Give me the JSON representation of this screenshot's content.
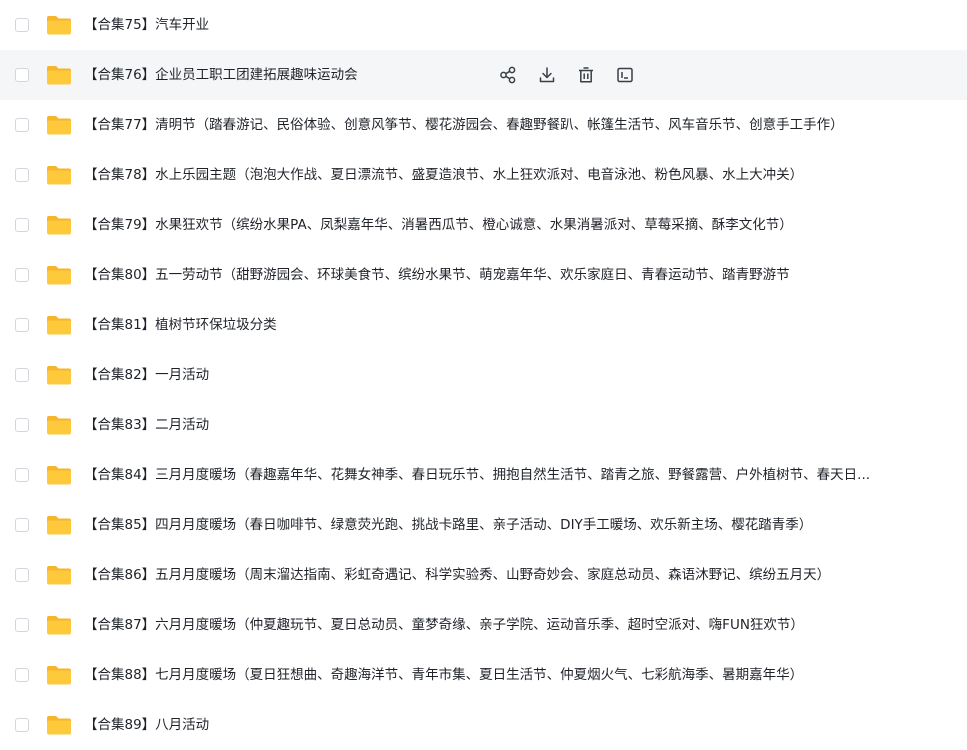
{
  "file_list": {
    "items": [
      {
        "name": "【合集75】汽车开业",
        "icon": "folder-icon"
      },
      {
        "name": "【合集76】企业员工职工团建拓展趣味运动会",
        "icon": "folder-icon",
        "hovered": true
      },
      {
        "name": "【合集77】清明节（踏春游记、民俗体验、创意风筝节、樱花游园会、春趣野餐趴、帐篷生活节、风车音乐节、创意手工手作）",
        "icon": "folder-icon"
      },
      {
        "name": "【合集78】水上乐园主题（泡泡大作战、夏日漂流节、盛夏造浪节、水上狂欢派对、电音泳池、粉色风暴、水上大冲关）",
        "icon": "folder-icon"
      },
      {
        "name": "【合集79】水果狂欢节（缤纷水果PA、凤梨嘉年华、消暑西瓜节、橙心诚意、水果消暑派对、草莓采摘、酥李文化节）",
        "icon": "folder-icon"
      },
      {
        "name": "【合集80】五一劳动节（甜野游园会、环球美食节、缤纷水果节、萌宠嘉年华、欢乐家庭日、青春运动节、踏青野游节",
        "icon": "folder-icon"
      },
      {
        "name": "【合集81】植树节环保垃圾分类",
        "icon": "folder-icon"
      },
      {
        "name": "【合集82】一月活动",
        "icon": "folder-icon"
      },
      {
        "name": "【合集83】二月活动",
        "icon": "folder-icon"
      },
      {
        "name": "【合集84】三月月度暖场（春趣嘉年华、花舞女神季、春日玩乐节、拥抱自然生活节、踏青之旅、野餐露营、户外植树节、春天日...",
        "icon": "folder-icon"
      },
      {
        "name": "【合集85】四月月度暖场（春日咖啡节、绿意荧光跑、挑战卡路里、亲子活动、DIY手工暖场、欢乐新主场、樱花踏青季）",
        "icon": "folder-icon"
      },
      {
        "name": "【合集86】五月月度暖场（周末溜达指南、彩虹奇遇记、科学实验秀、山野奇妙会、家庭总动员、森语沐野记、缤纷五月天）",
        "icon": "folder-icon"
      },
      {
        "name": "【合集87】六月月度暖场（仲夏趣玩节、夏日总动员、童梦奇缘、亲子学院、运动音乐季、超时空派对、嗨FUN狂欢节）",
        "icon": "folder-icon"
      },
      {
        "name": "【合集88】七月月度暖场（夏日狂想曲、奇趣海洋节、青年市集、夏日生活节、仲夏烟火气、七彩航海季、暑期嘉年华）",
        "icon": "folder-icon"
      },
      {
        "name": "【合集89】八月活动",
        "icon": "folder-icon"
      }
    ],
    "row_actions": [
      "share-icon",
      "download-icon",
      "delete-icon",
      "rename-icon"
    ]
  },
  "colors": {
    "folder": "#ffc93c",
    "folder_tab": "#f7b52b",
    "hover_background": "#f5f6f8",
    "icon": "#3a3f45"
  }
}
